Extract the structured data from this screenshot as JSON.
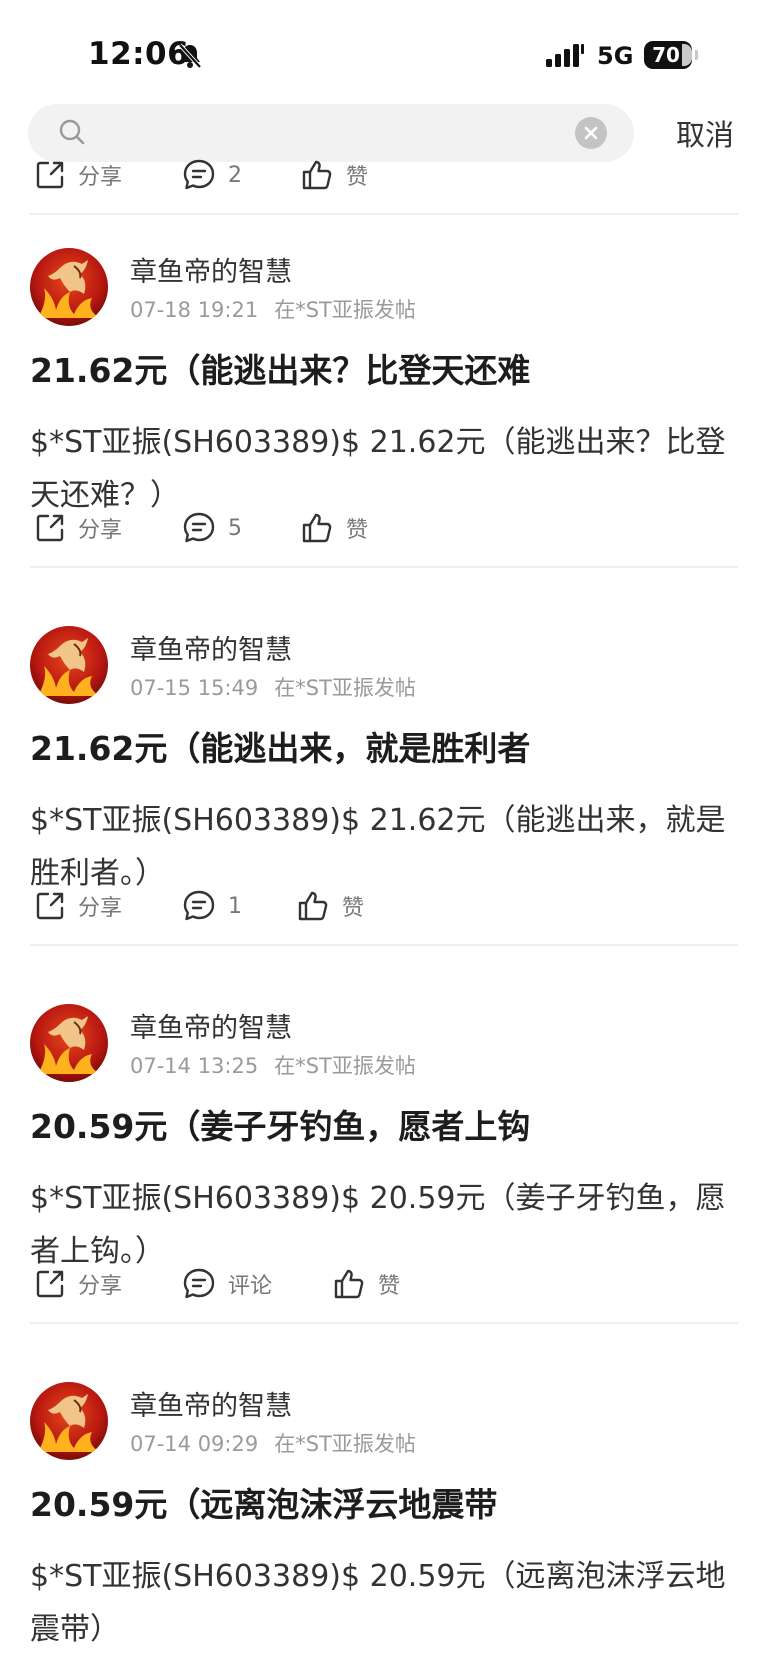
{
  "status_bar": {
    "time": "12:06",
    "network": "5G",
    "battery": "70"
  },
  "search": {
    "placeholder": "",
    "cancel_label": "取消"
  },
  "top_action_bar": {
    "share": "分享",
    "comments": "2",
    "like": "赞"
  },
  "posts": [
    {
      "author": "章鱼帝的智慧",
      "time": "07-18 19:21",
      "location": "在*ST亚振发帖",
      "title": "21.62元（能逃出来？比登天还难",
      "body": "$*ST亚振(SH603389)$ 21.62元（能逃出来？比登天还难？）",
      "share": "分享",
      "comments": "5",
      "like": "赞"
    },
    {
      "author": "章鱼帝的智慧",
      "time": "07-15 15:49",
      "location": "在*ST亚振发帖",
      "title": "21.62元（能逃出来，就是胜利者",
      "body": "$*ST亚振(SH603389)$ 21.62元（能逃出来，就是胜利者。）",
      "share": "分享",
      "comments": "1",
      "like": "赞"
    },
    {
      "author": "章鱼帝的智慧",
      "time": "07-14 13:25",
      "location": "在*ST亚振发帖",
      "title": "20.59元（姜子牙钓鱼，愿者上钩",
      "body": "$*ST亚振(SH603389)$ 20.59元（姜子牙钓鱼，愿者上钩。）",
      "share": "分享",
      "comments": "评论",
      "like": "赞"
    },
    {
      "author": "章鱼帝的智慧",
      "time": "07-14 09:29",
      "location": "在*ST亚振发帖",
      "title": "20.59元（远离泡沫浮云地震带",
      "body": "$*ST亚振(SH603389)$ 20.59元（远离泡沫浮云地震带）"
    }
  ],
  "icons": {
    "share": "share-icon",
    "comment": "comment-icon",
    "like": "thumbs-up-icon",
    "search": "search-icon",
    "clear": "clear-icon",
    "mute": "bell-slash-icon"
  }
}
